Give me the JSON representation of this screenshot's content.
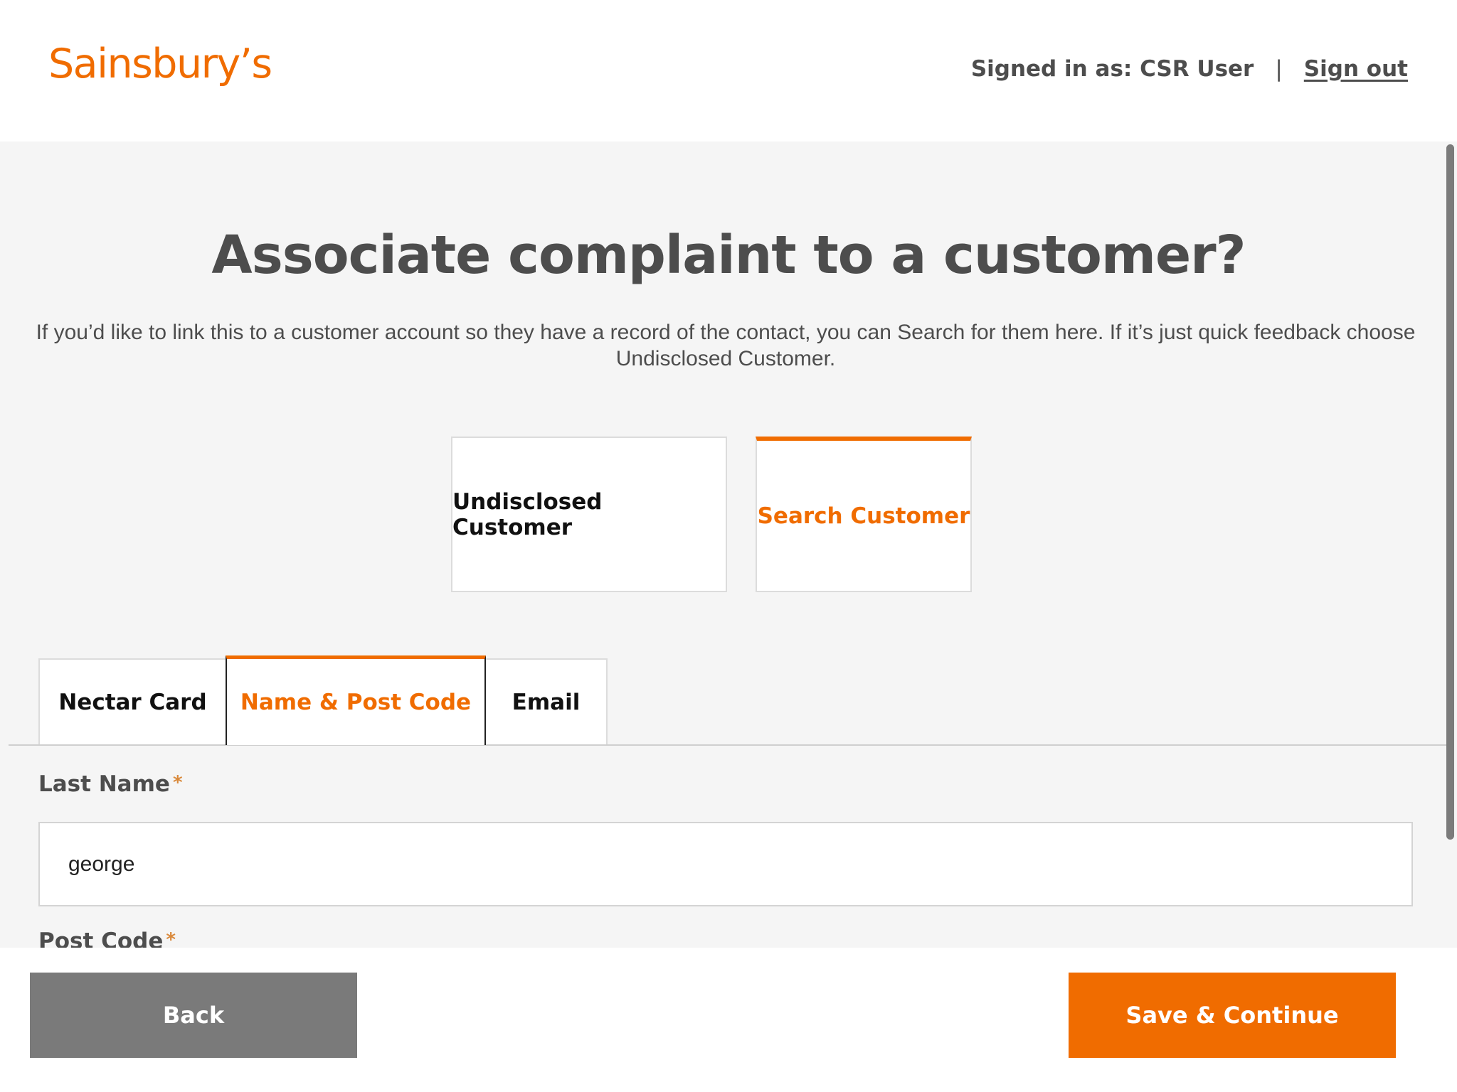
{
  "header": {
    "logo_text": "Sainsbury’s",
    "signed_in_label": "Signed in as: CSR User",
    "separator": "|",
    "sign_out_label": "Sign out"
  },
  "main": {
    "title": "Associate complaint to a customer?",
    "intro": "If you’d like to link this to a customer account so they have a record of the contact, you can Search for them here. If it’s just quick feedback choose Undisclosed Customer.",
    "options": {
      "undisclosed_label": "Undisclosed Customer",
      "search_label": "Search Customer",
      "selected": "Search Customer"
    },
    "tabs": {
      "nectar_label": "Nectar Card",
      "name_post_label": "Name & Post Code",
      "email_label": "Email",
      "active": "Name & Post Code"
    },
    "form": {
      "last_name_label": "Last Name",
      "last_name_value": "george",
      "post_code_label": "Post Code",
      "required_marker": "*"
    }
  },
  "footer": {
    "back_label": "Back",
    "save_label": "Save & Continue"
  },
  "colors": {
    "brand_orange": "#f06c00",
    "text_grey": "#4d4d4d",
    "back_button": "#7a7a7a",
    "page_background": "#f5f5f5"
  }
}
